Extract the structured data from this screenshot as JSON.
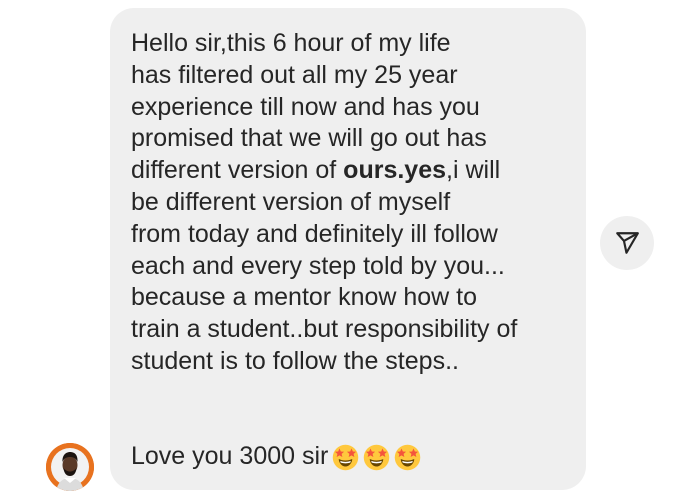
{
  "message": {
    "lines": [
      "Hello sir,this 6 hour of my life",
      "has filtered out all my 25 year",
      "experience till now and has you",
      "promised that we will go out has",
      "different version of ",
      "be different version of myself",
      "from today and definitely ill follow",
      "each and every step told by you...",
      "because a mentor know how to",
      "train a student..but responsibility of",
      "student is to follow the steps.."
    ],
    "line5_bold": "ours.yes",
    "line5_suffix": ",i will",
    "closing": "Love you 3000 sir",
    "emoji_count": 3,
    "emoji_icon": "star-struck-emoji-icon"
  },
  "share_button": {
    "icon": "send-icon"
  },
  "avatar": {
    "icon": "user-avatar"
  },
  "colors": {
    "bubble_bg": "#efefef",
    "text": "#262626",
    "avatar_ring": "#e8721f",
    "emoji_face": "#ffc83d",
    "emoji_star": "#f4553c"
  }
}
